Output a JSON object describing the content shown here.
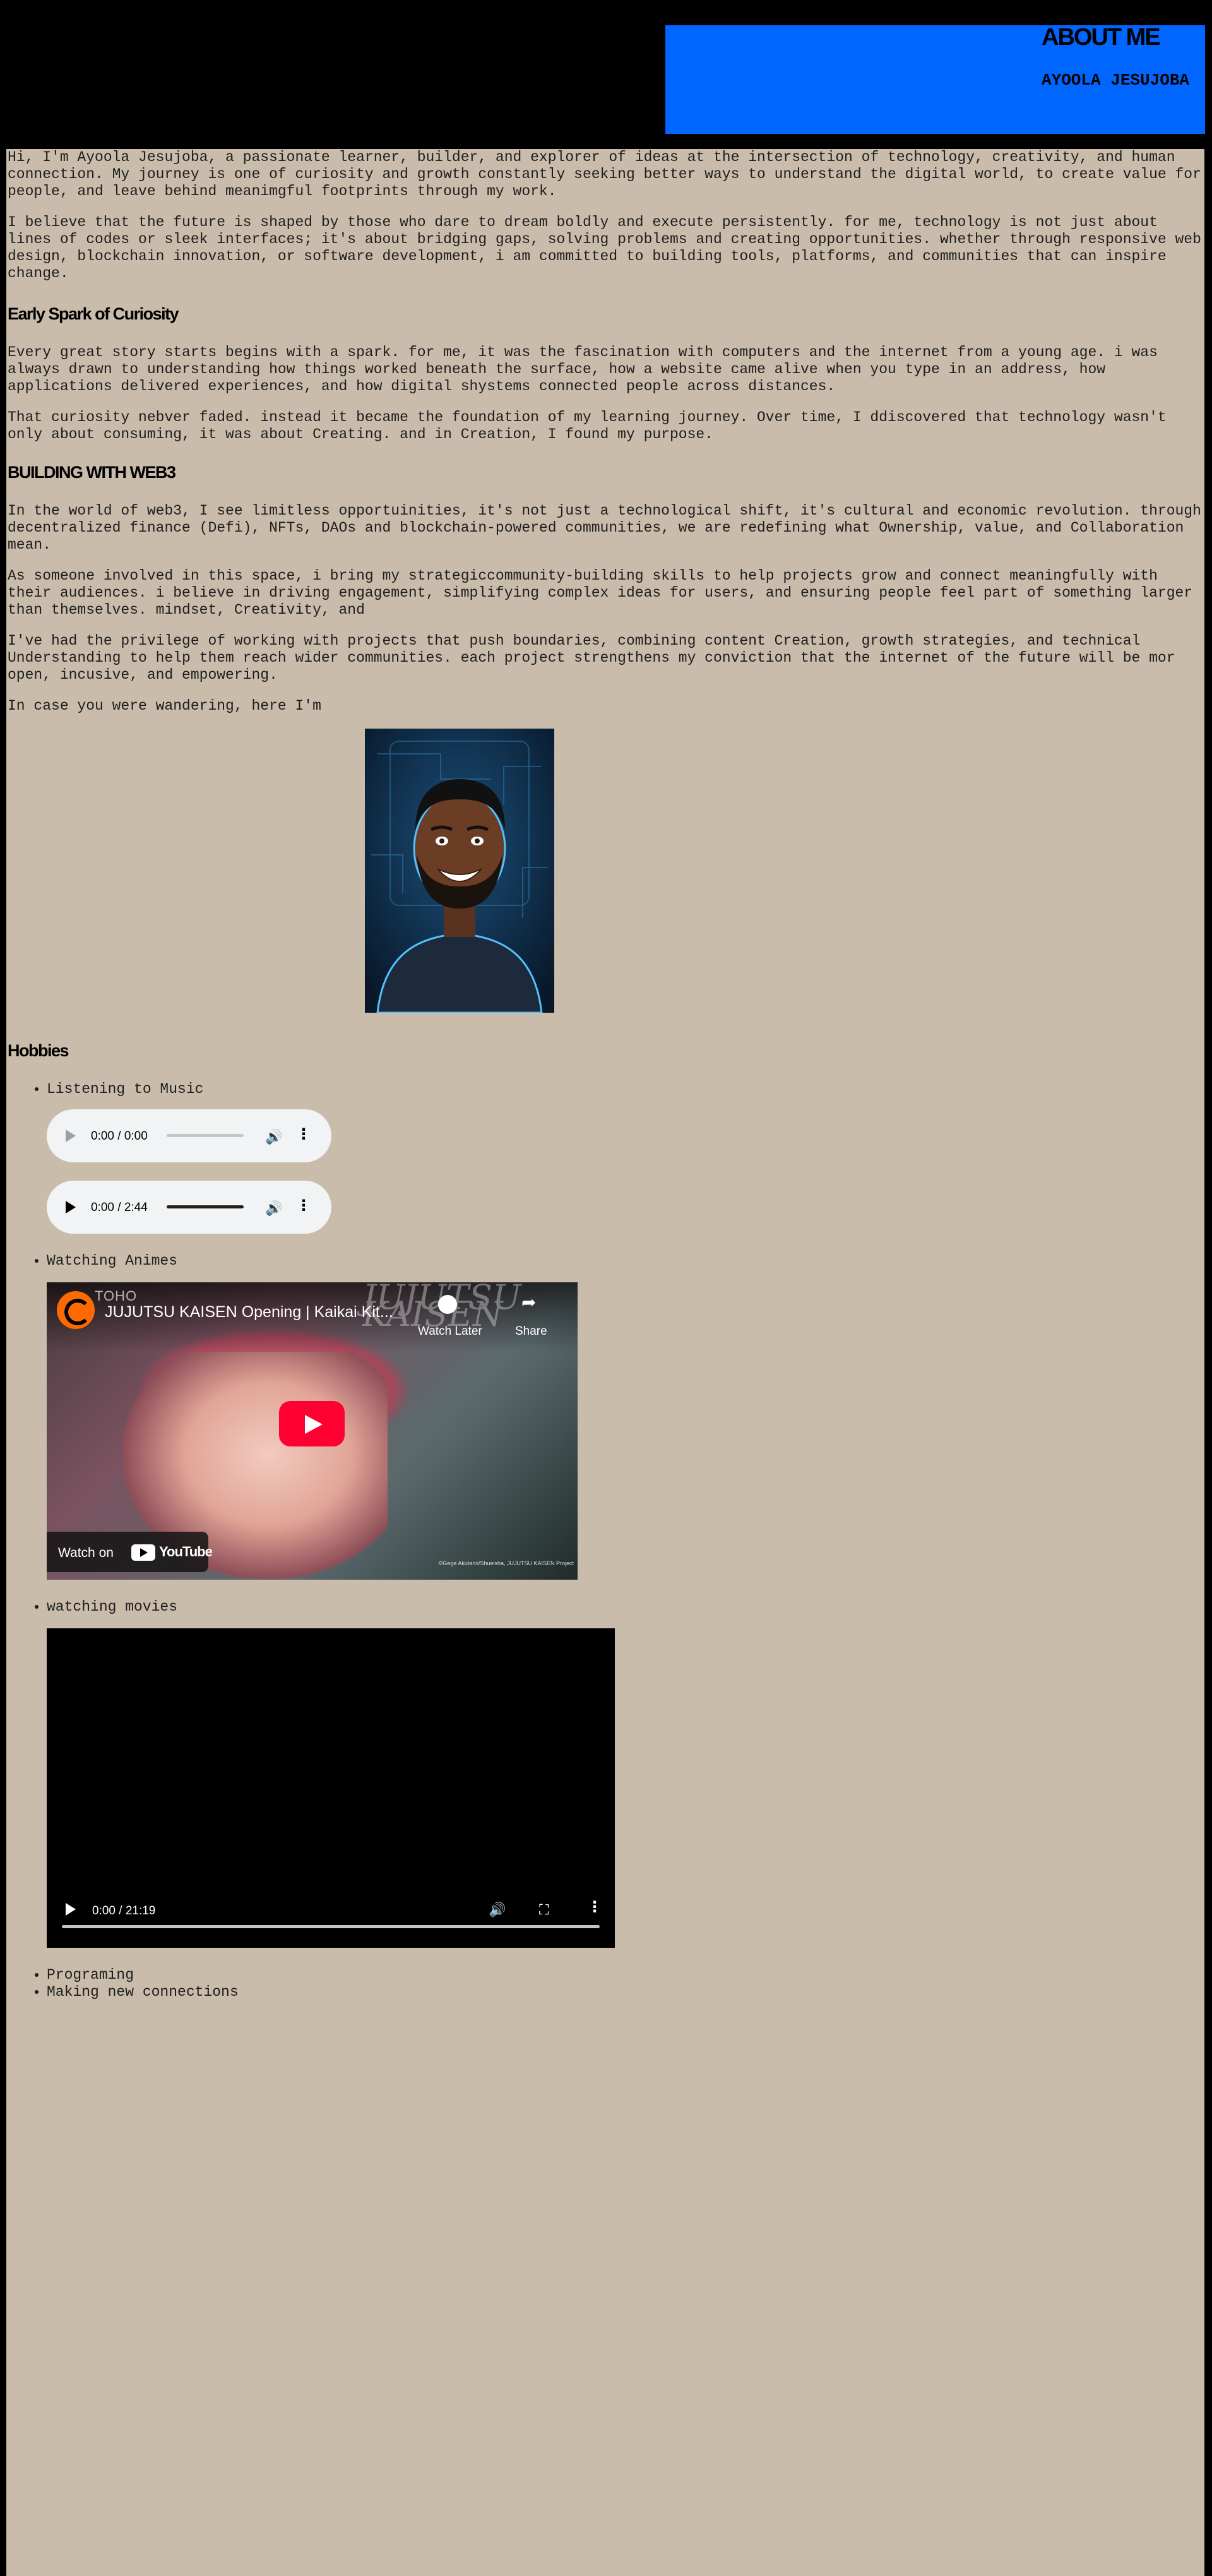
{
  "header": {
    "title": "ABOUT ME",
    "name": "AYOOLA JESUJOBA",
    "accent_color": "#0066ff"
  },
  "intro": {
    "p1": "Hi, I'm Ayoola Jesujoba, a passionate learner, builder, and explorer of ideas at the intersection of technology, creativity, and human connection. My journey is one of curiosity and growth constantly seeking better ways to understand the digital world, to create value for people, and leave behind meanimgful footprints through my work.",
    "p2": "I believe that the future is shaped by those who dare to dream boldly and execute persistently. for me, technology is not just about lines of codes or sleek interfaces; it's about bridging gaps, solving problems and creating opportunities. whether through responsive web design, blockchain innovation, or software development, i am committed to building tools, platforms, and communities that can inspire change."
  },
  "section_spark": {
    "title": "Early Spark of Curiosity",
    "p1": "Every great story starts begins with a spark. for me, it was the fascination with computers and the internet from a young age. i was always drawn to understanding how things worked beneath the surface, how a website came alive when you type in an address, how applications delivered experiences, and how digital shystems connected people across distances.",
    "p2": "That curiosity nebver faded. instead it became the foundation of my learning journey. Over time, I ddiscovered that technology wasn't only about consuming, it was about Creating. and in Creation, I found my purpose."
  },
  "section_web3": {
    "title": "BUILDING WITH WEB3",
    "p1": "In the world of web3, I see limitless opportuinities, it's not just a technological shift, it's cultural and economic revolution. through decentralized finance (Defi), NFTs, DAOs and blockchain-powered communities, we are redefining what Ownership, value, and Collaboration mean.",
    "p2": "As someone involved in this space, i bring my strategiccommunity-building skills to help projects grow and connect meaningfully with their audiences. i believe in driving engagement, simplifying complex ideas for users, and ensuring people feel part of something larger than themselves. mindset, Creativity, and",
    "p3": "I've had the privilege of working with projects that push boundaries, combining content Creation, growth strategies, and technical Understanding to help them reach wider communities. each project strengthens my conviction that the internet of the future will be mor open, incusive, and empowering.",
    "p4": "In case you were wandering, here I'm"
  },
  "profile_image": {
    "icon": "cartoon-avatar-portrait"
  },
  "hobbies": {
    "title": "Hobbies",
    "items": [
      "Listening to Music",
      "Watching Animes",
      "watching movies",
      "Programing",
      "Making new connections"
    ],
    "audio_players": [
      {
        "time": "0:00 / 0:00",
        "disabled": true
      },
      {
        "time": "0:00 / 2:44",
        "disabled": false
      }
    ],
    "youtube": {
      "channel": "TOHO",
      "title": "JUJUTSU KAISEN Opening | Kaikai Kit...",
      "watch_later": "Watch Later",
      "share": "Share",
      "watch_on": "Watch on",
      "youtube_word": "YouTube",
      "logo_text": "JUJUTSU KAISEN",
      "copyright": "©Gege Akutami/Shueisha, JUJUTSU KAISEN Project"
    },
    "video": {
      "time": "0:00 / 21:19"
    }
  }
}
